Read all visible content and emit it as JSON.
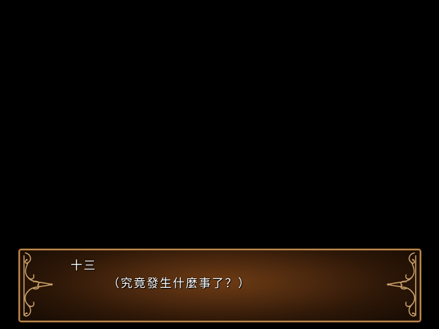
{
  "dialog": {
    "speaker": "十三",
    "text": "（究竟發生什麼事了？）"
  },
  "colors": {
    "background": "#000000",
    "box_center": "#6e3c14",
    "box_edge": "#1a0d04",
    "border_gold": "#b88a52",
    "text": "#ffffff"
  },
  "icons": {
    "left_ornament": "scroll-flourish-icon",
    "right_ornament": "scroll-flourish-icon"
  }
}
